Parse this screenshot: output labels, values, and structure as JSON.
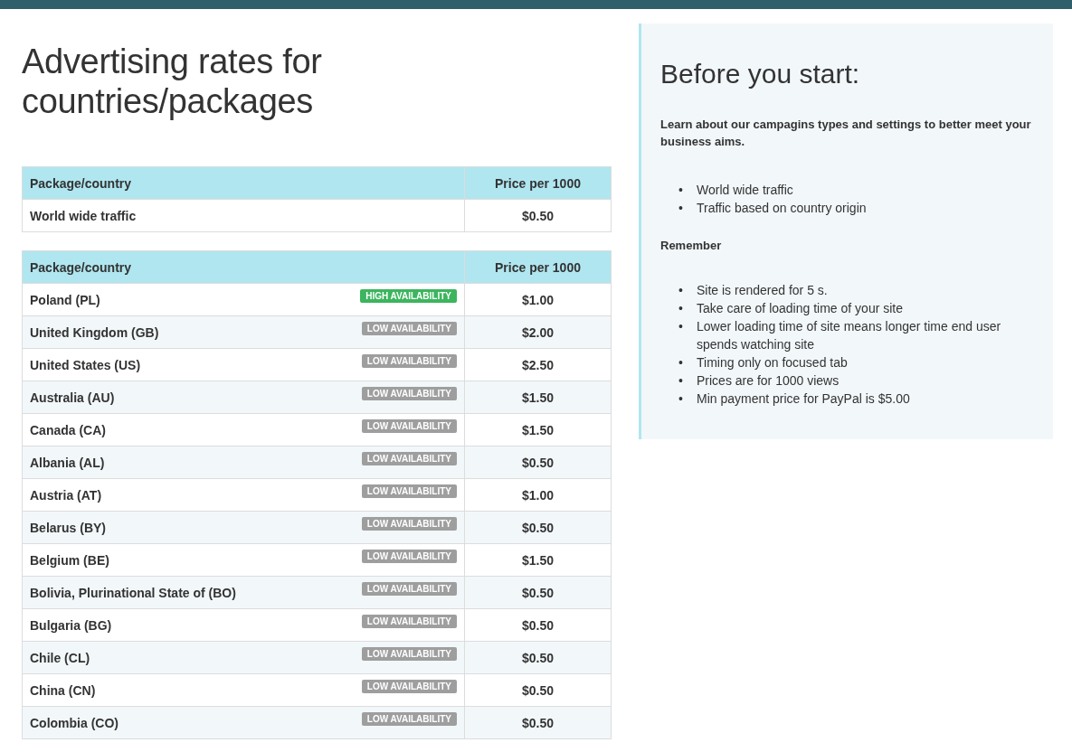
{
  "page_title": "Advertising rates for countries/packages",
  "packages_table": {
    "columns": [
      "Package/country",
      "Price per 1000"
    ],
    "rows": [
      {
        "name": "World wide traffic",
        "price": "$0.50"
      }
    ]
  },
  "countries_table": {
    "columns": [
      "Package/country",
      "Price per 1000"
    ],
    "rows": [
      {
        "name": "Poland (PL)",
        "availability": {
          "kind": "high",
          "label": "HIGH AVAILABILITY"
        },
        "price": "$1.00"
      },
      {
        "name": "United Kingdom (GB)",
        "availability": {
          "kind": "low",
          "label": "LOW AVAILABILITY"
        },
        "price": "$2.00"
      },
      {
        "name": "United States (US)",
        "availability": {
          "kind": "low",
          "label": "LOW AVAILABILITY"
        },
        "price": "$2.50"
      },
      {
        "name": "Australia (AU)",
        "availability": {
          "kind": "low",
          "label": "LOW AVAILABILITY"
        },
        "price": "$1.50"
      },
      {
        "name": "Canada (CA)",
        "availability": {
          "kind": "low",
          "label": "LOW AVAILABILITY"
        },
        "price": "$1.50"
      },
      {
        "name": "Albania (AL)",
        "availability": {
          "kind": "low",
          "label": "LOW AVAILABILITY"
        },
        "price": "$0.50"
      },
      {
        "name": "Austria (AT)",
        "availability": {
          "kind": "low",
          "label": "LOW AVAILABILITY"
        },
        "price": "$1.00"
      },
      {
        "name": "Belarus (BY)",
        "availability": {
          "kind": "low",
          "label": "LOW AVAILABILITY"
        },
        "price": "$0.50"
      },
      {
        "name": "Belgium (BE)",
        "availability": {
          "kind": "low",
          "label": "LOW AVAILABILITY"
        },
        "price": "$1.50"
      },
      {
        "name": "Bolivia, Plurinational State of (BO)",
        "availability": {
          "kind": "low",
          "label": "LOW AVAILABILITY"
        },
        "price": "$0.50"
      },
      {
        "name": "Bulgaria (BG)",
        "availability": {
          "kind": "low",
          "label": "LOW AVAILABILITY"
        },
        "price": "$0.50"
      },
      {
        "name": "Chile (CL)",
        "availability": {
          "kind": "low",
          "label": "LOW AVAILABILITY"
        },
        "price": "$0.50"
      },
      {
        "name": "China (CN)",
        "availability": {
          "kind": "low",
          "label": "LOW AVAILABILITY"
        },
        "price": "$0.50"
      },
      {
        "name": "Colombia (CO)",
        "availability": {
          "kind": "low",
          "label": "LOW AVAILABILITY"
        },
        "price": "$0.50"
      }
    ]
  },
  "info_panel": {
    "title": "Before you start:",
    "intro": "Learn about our campagins types and settings to better meet your business aims.",
    "campaign_types": [
      {
        "marker": "•",
        "text": "World wide traffic"
      },
      {
        "marker": "•",
        "text": "Traffic based on country origin"
      }
    ],
    "remember_heading": "Remember",
    "remember_items": [
      {
        "marker": "•",
        "text": "Site is rendered for 5 s."
      },
      {
        "marker": "•",
        "text": "Take care of loading time of your site"
      },
      {
        "marker": "•",
        "text": "Lower loading time of site means longer time end user spends watching site"
      },
      {
        "marker": "•",
        "text": "Timing only on focused tab"
      },
      {
        "marker": "•",
        "text": "Prices are for 1000 views"
      },
      {
        "marker": "•",
        "text": "Min payment price for PayPal is $5.00"
      }
    ]
  }
}
